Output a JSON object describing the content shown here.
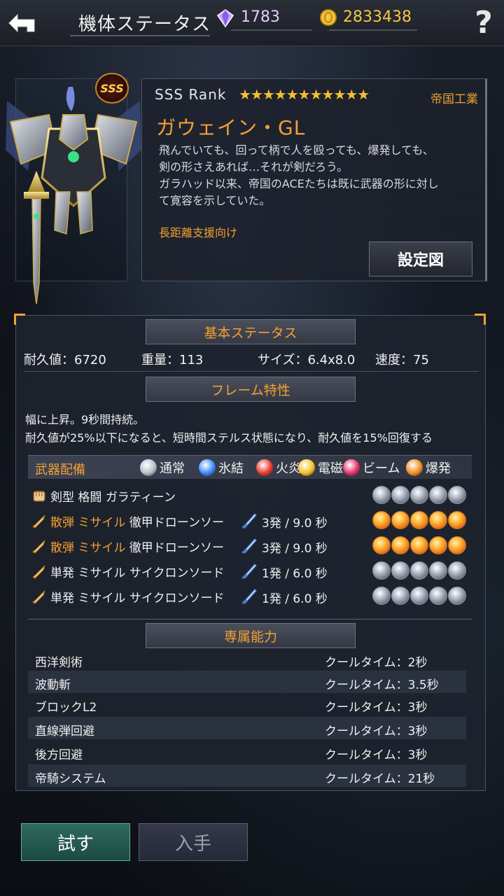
{
  "header": {
    "title": "機体ステータス",
    "gems": "1783",
    "coins": "2833438"
  },
  "unit": {
    "rank_badge": "SSS",
    "rank_label": "SSS  Rank",
    "stars": "★★★★★★★★★★★",
    "maker": "帝国工業",
    "name": "ガウェイン・GL",
    "desc_1": "飛んでいても、回って柄で人を殴っても、爆発しても、",
    "desc_2": "剣の形さえあれば…それが剣だろう。",
    "desc_3": "ガラハッド以来、帝国のACEたちは既に武器の形に対し",
    "desc_4": "て寛容を示していた。",
    "role": "長距離支援向け",
    "blueprint_button": "設定図"
  },
  "basic_stats": {
    "header": "基本ステータス",
    "durability": "耐久値：6720",
    "weight": "重量：113",
    "size": "サイズ：6.4x8.0",
    "speed": "速度：75"
  },
  "frame": {
    "header": "フレーム特性",
    "line_1": "幅に上昇。9秒間持続。",
    "line_2": "耐久値が25%以下になると、短時間ステルス状態になり、耐久値を15%回復する"
  },
  "weapons": {
    "header": "武器配備",
    "elements": [
      {
        "label": "通常",
        "color": "#b9bdc8"
      },
      {
        "label": "氷結",
        "color": "#3a8cff"
      },
      {
        "label": "火炎",
        "color": "#e83a2a"
      },
      {
        "label": "電磁",
        "color": "#f5c020"
      },
      {
        "label": "ビーム",
        "color": "#e8306a"
      },
      {
        "label": "爆発",
        "color": "#f58a20"
      }
    ],
    "rows": [
      {
        "type": "剣型 格闘",
        "type_orange": false,
        "name": "ガラティーン",
        "shots": "",
        "orb": "normal"
      },
      {
        "type": "散弾 ミサイル",
        "type_orange": true,
        "name": "徹甲ドローンソー",
        "shots": "3発 / 9.0 秒",
        "orb": "explode"
      },
      {
        "type": "散弾 ミサイル",
        "type_orange": true,
        "name": "徹甲ドローンソー",
        "shots": "3発 / 9.0 秒",
        "orb": "explode"
      },
      {
        "type": "単発 ミサイル",
        "type_orange": false,
        "name": "サイクロンソード",
        "shots": "1発 / 6.0 秒",
        "orb": "normal"
      },
      {
        "type": "単発 ミサイル",
        "type_orange": false,
        "name": "サイクロンソード",
        "shots": "1発 / 6.0 秒",
        "orb": "normal"
      }
    ]
  },
  "abilities": {
    "header": "専属能力",
    "rows": [
      {
        "name": "西洋剣術",
        "cooldown": "クールタイム：2秒"
      },
      {
        "name": "波動斬",
        "cooldown": "クールタイム：3.5秒"
      },
      {
        "name": "ブロックL2",
        "cooldown": "クールタイム：3秒"
      },
      {
        "name": "直線弾回避",
        "cooldown": "クールタイム：3秒"
      },
      {
        "name": "後方回避",
        "cooldown": "クールタイム：3秒"
      },
      {
        "name": "帝騎システム",
        "cooldown": "クールタイム：21秒"
      }
    ]
  },
  "buttons": {
    "try": "試す",
    "get": "入手"
  }
}
